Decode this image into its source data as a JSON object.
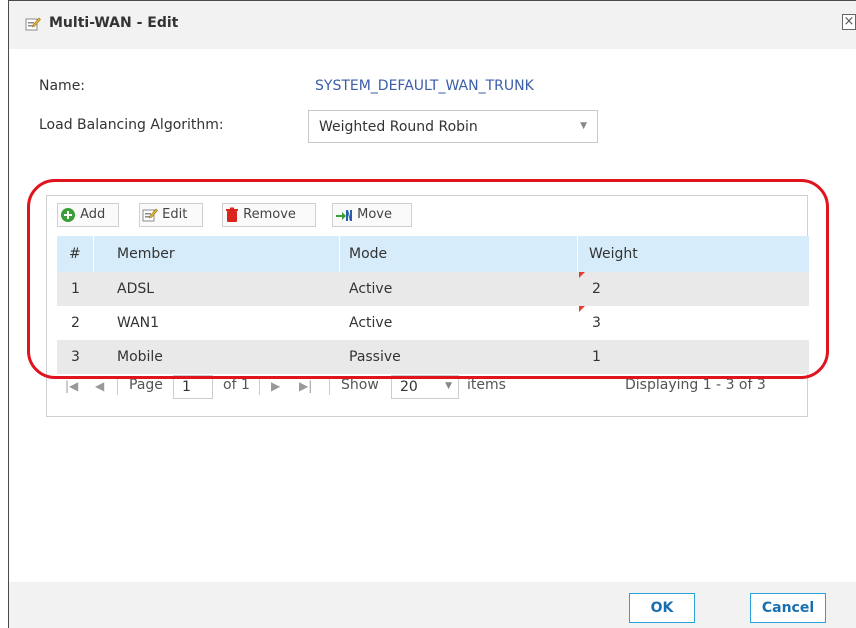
{
  "dialog": {
    "title": "Multi-WAN - Edit",
    "close_symbol": "×"
  },
  "form": {
    "name_label": "Name:",
    "name_value": "SYSTEM_DEFAULT_WAN_TRUNK",
    "algorithm_label": "Load Balancing Algorithm:",
    "algorithm_value": "Weighted Round Robin"
  },
  "toolbar": {
    "add": "Add",
    "edit": "Edit",
    "remove": "Remove",
    "move": "Move"
  },
  "table": {
    "columns": [
      "#",
      "Member",
      "Mode",
      "Weight"
    ],
    "rows": [
      {
        "index": "1",
        "member": "ADSL",
        "mode": "Active",
        "weight": "2"
      },
      {
        "index": "2",
        "member": "WAN1",
        "mode": "Active",
        "weight": "3"
      },
      {
        "index": "3",
        "member": "Mobile",
        "mode": "Passive",
        "weight": "1"
      }
    ]
  },
  "pager": {
    "page_label": "Page",
    "page_value": "1",
    "of_label": "of 1",
    "show_label": "Show",
    "page_size": "20",
    "items_label": "items",
    "displaying": "Displaying 1 - 3 of 3"
  },
  "footer": {
    "ok": "OK",
    "cancel": "Cancel"
  },
  "colors": {
    "accent": "#2a9fd8",
    "header_bg": "#d7ecfa",
    "highlight": "#e0141e",
    "link": "#3b5ea8"
  }
}
